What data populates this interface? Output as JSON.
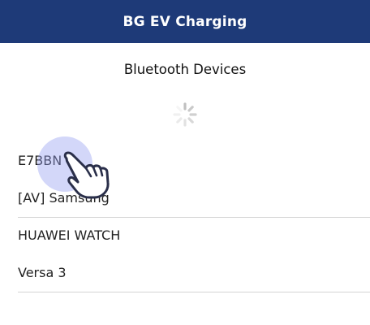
{
  "header": {
    "title": "BG EV Charging"
  },
  "section": {
    "title": "Bluetooth Devices"
  },
  "devices": [
    {
      "label": "E7BBN",
      "divider": false
    },
    {
      "label": "[AV] Samsung",
      "divider": true
    },
    {
      "label": "HUAWEI WATCH",
      "divider": false
    },
    {
      "label": "Versa 3",
      "divider": true
    }
  ],
  "colors": {
    "header_bg": "#1e3a78",
    "tap_highlight": "#96a0f0"
  },
  "icons": {
    "spinner": "loading-spinner-icon",
    "pointer": "tap-hand-icon"
  }
}
